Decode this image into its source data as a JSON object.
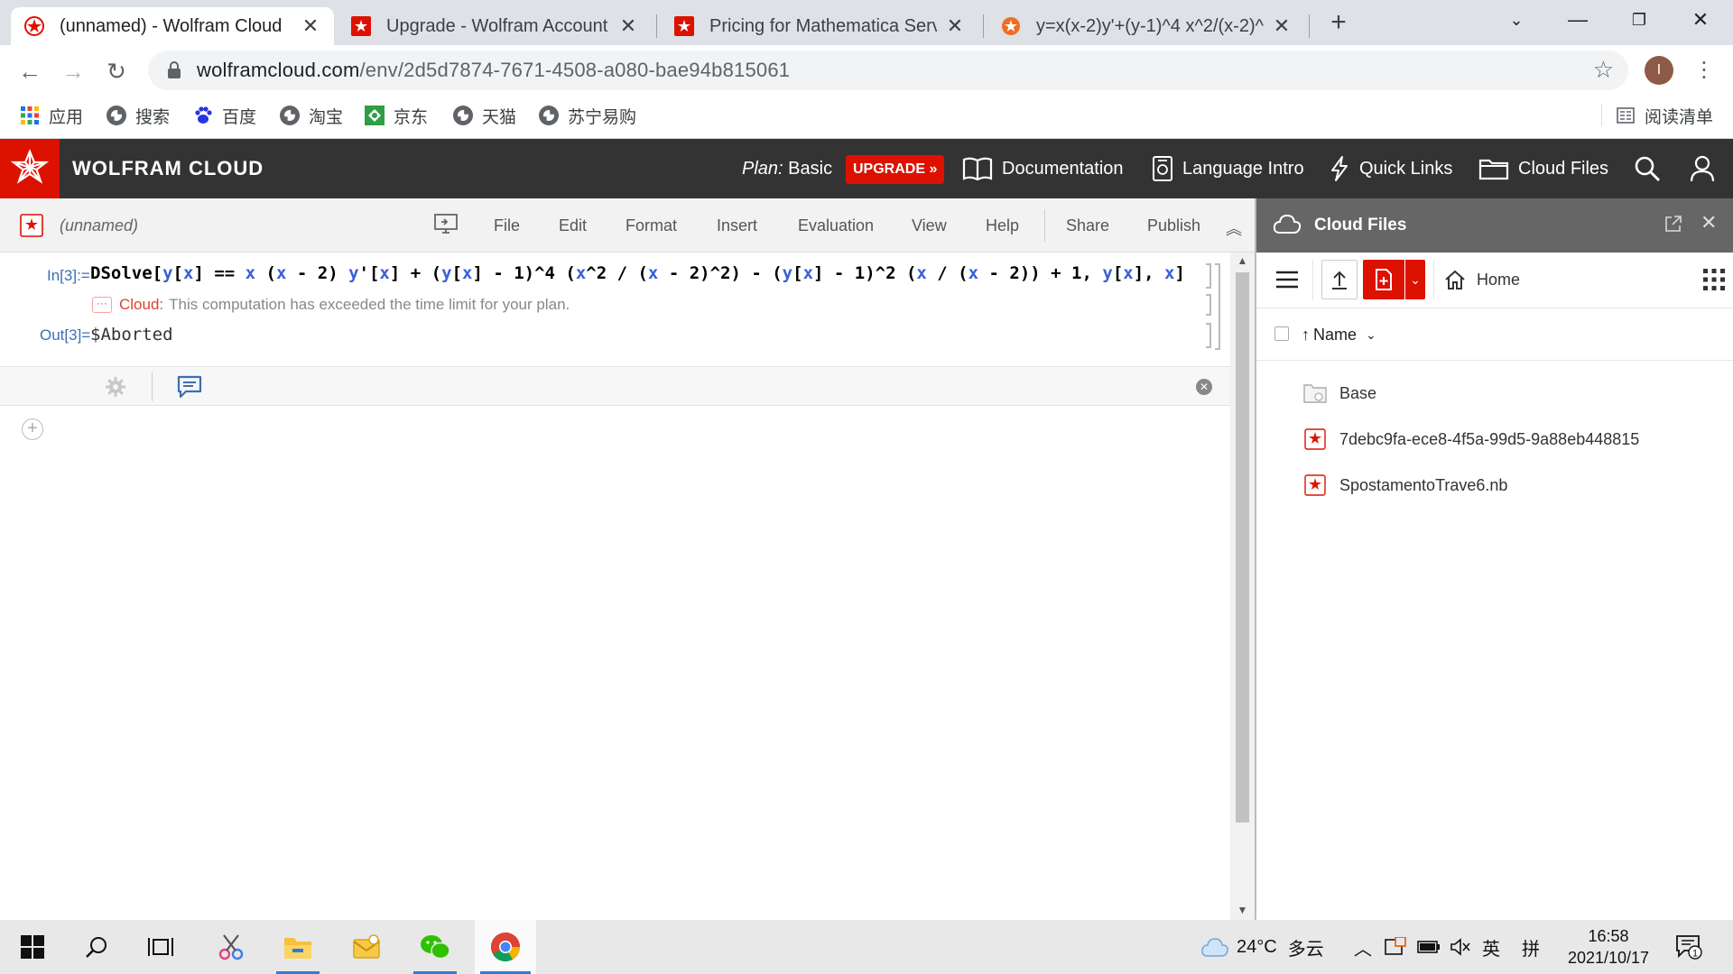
{
  "browser": {
    "tabs": [
      {
        "title": "(unnamed) - Wolfram Cloud",
        "active": true
      },
      {
        "title": "Upgrade - Wolfram Account",
        "active": false
      },
      {
        "title": "Pricing for Mathematica Servic",
        "active": false
      },
      {
        "title": "y=x(x-2)y'+(y-1)^4 x^2/(x-2)^",
        "active": false
      }
    ],
    "new_tab": "+",
    "url_host": "wolframcloud.com",
    "url_path": "/env/2d5d7874-7671-4508-a080-bae94b815061",
    "avatar_letter": "I",
    "bookmarks": [
      {
        "label": "应用"
      },
      {
        "label": "搜索"
      },
      {
        "label": "百度"
      },
      {
        "label": "淘宝"
      },
      {
        "label": "京东"
      },
      {
        "label": "天猫"
      },
      {
        "label": "苏宁易购"
      }
    ],
    "reading_list": "阅读清单"
  },
  "header": {
    "title": "WOLFRAM CLOUD",
    "plan_label": "Plan:",
    "plan_value": "Basic",
    "upgrade": "UPGRADE »",
    "links": [
      "Documentation",
      "Language Intro",
      "Quick Links",
      "Cloud Files"
    ]
  },
  "notebook": {
    "name": "(unnamed)",
    "menus": [
      "File",
      "Edit",
      "Format",
      "Insert",
      "Evaluation",
      "View",
      "Help",
      "Share",
      "Publish"
    ],
    "in_label": "In[3]:=",
    "out_label": "Out[3]=",
    "message_source": "Cloud:",
    "message_text": "This computation has exceeded the time limit for your plan.",
    "output": "$Aborted"
  },
  "cloud_files": {
    "title": "Cloud Files",
    "home": "Home",
    "sort_column": "Name",
    "files": [
      {
        "name": "Base",
        "kind": "folder"
      },
      {
        "name": "7debc9fa-ece8-4f5a-99d5-9a88eb448815",
        "kind": "notebook"
      },
      {
        "name": "SpostamentoTrave6.nb",
        "kind": "notebook"
      }
    ]
  },
  "taskbar": {
    "weather_temp": "24°C",
    "weather_text": "多云",
    "ime_lang": "英",
    "ime_mode": "拼",
    "time": "16:58",
    "date": "2021/10/17",
    "notifications": "1"
  },
  "colors": {
    "wolfram_red": "#dd1100",
    "header_dark": "#333333",
    "code_blue": "#3b5fd9"
  }
}
